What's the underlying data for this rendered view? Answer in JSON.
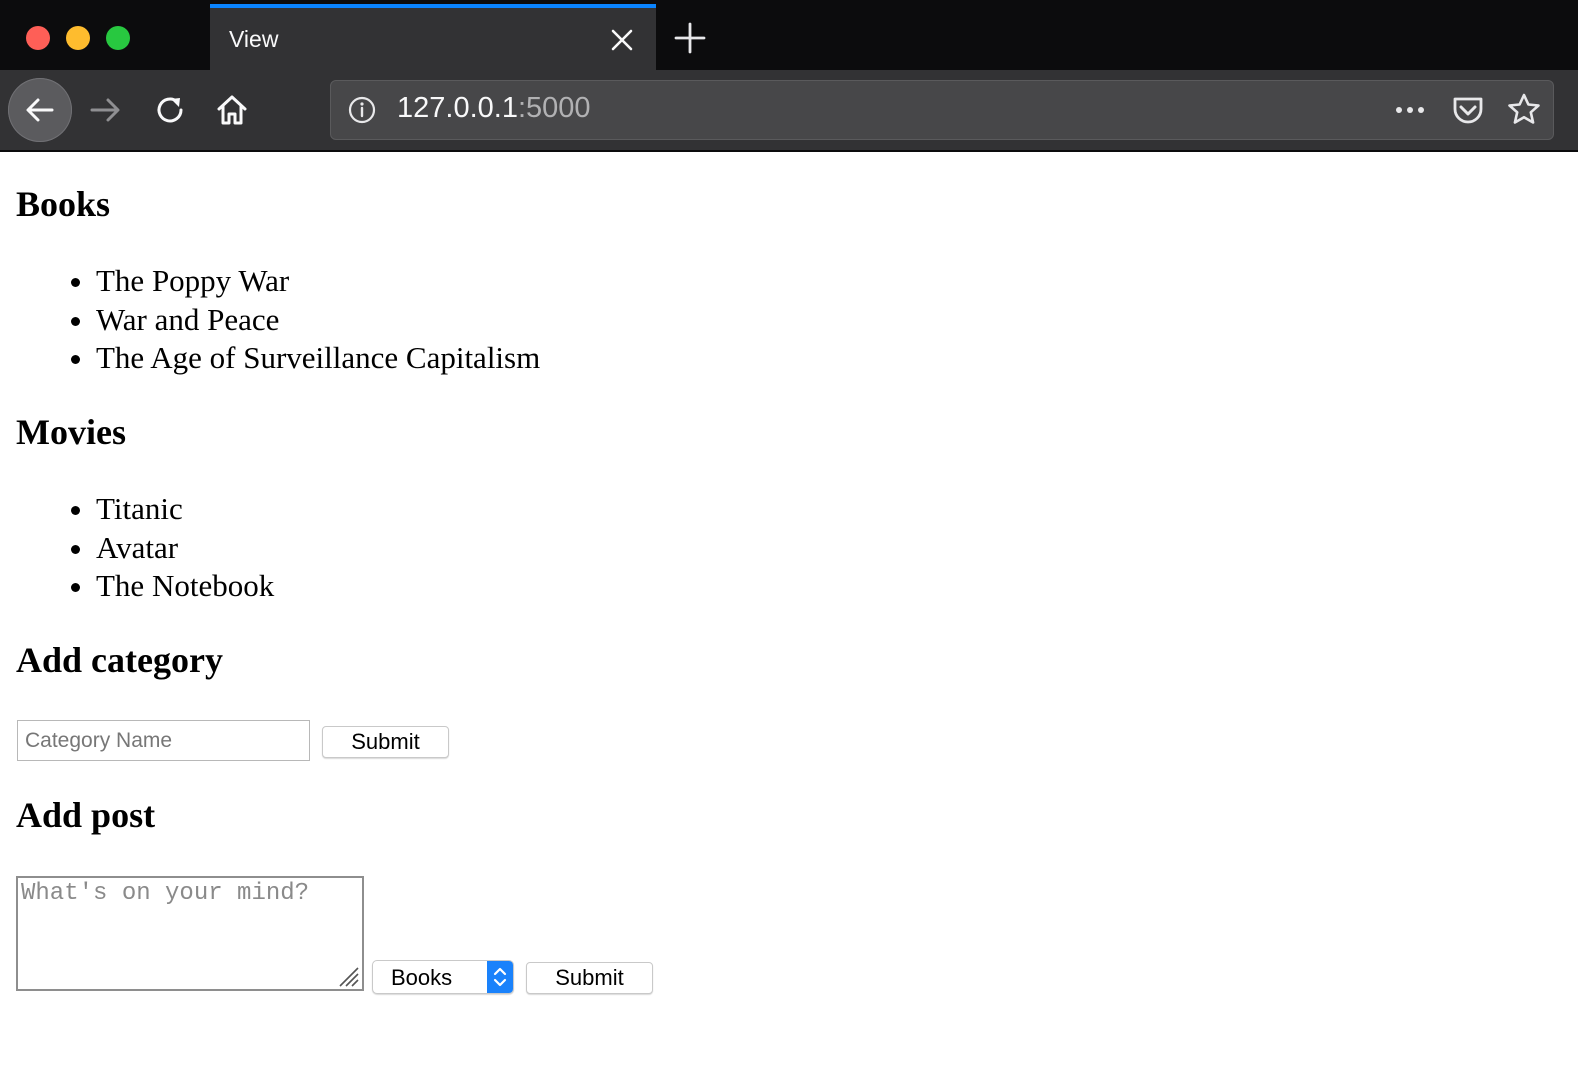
{
  "browser": {
    "tab_title": "View",
    "url_host": "127.0.0.1",
    "url_port": ":5000"
  },
  "sections": {
    "books": {
      "heading": "Books",
      "items": [
        "The Poppy War",
        "War and Peace",
        "The Age of Surveillance Capitalism"
      ]
    },
    "movies": {
      "heading": "Movies",
      "items": [
        "Titanic",
        "Avatar",
        "The Notebook"
      ]
    }
  },
  "add_category": {
    "heading": "Add category",
    "input_placeholder": "Category Name",
    "input_value": "",
    "submit_label": "Submit"
  },
  "add_post": {
    "heading": "Add post",
    "textarea_placeholder": "What's on your mind?",
    "category_selected": "Books",
    "submit_label": "Submit"
  }
}
